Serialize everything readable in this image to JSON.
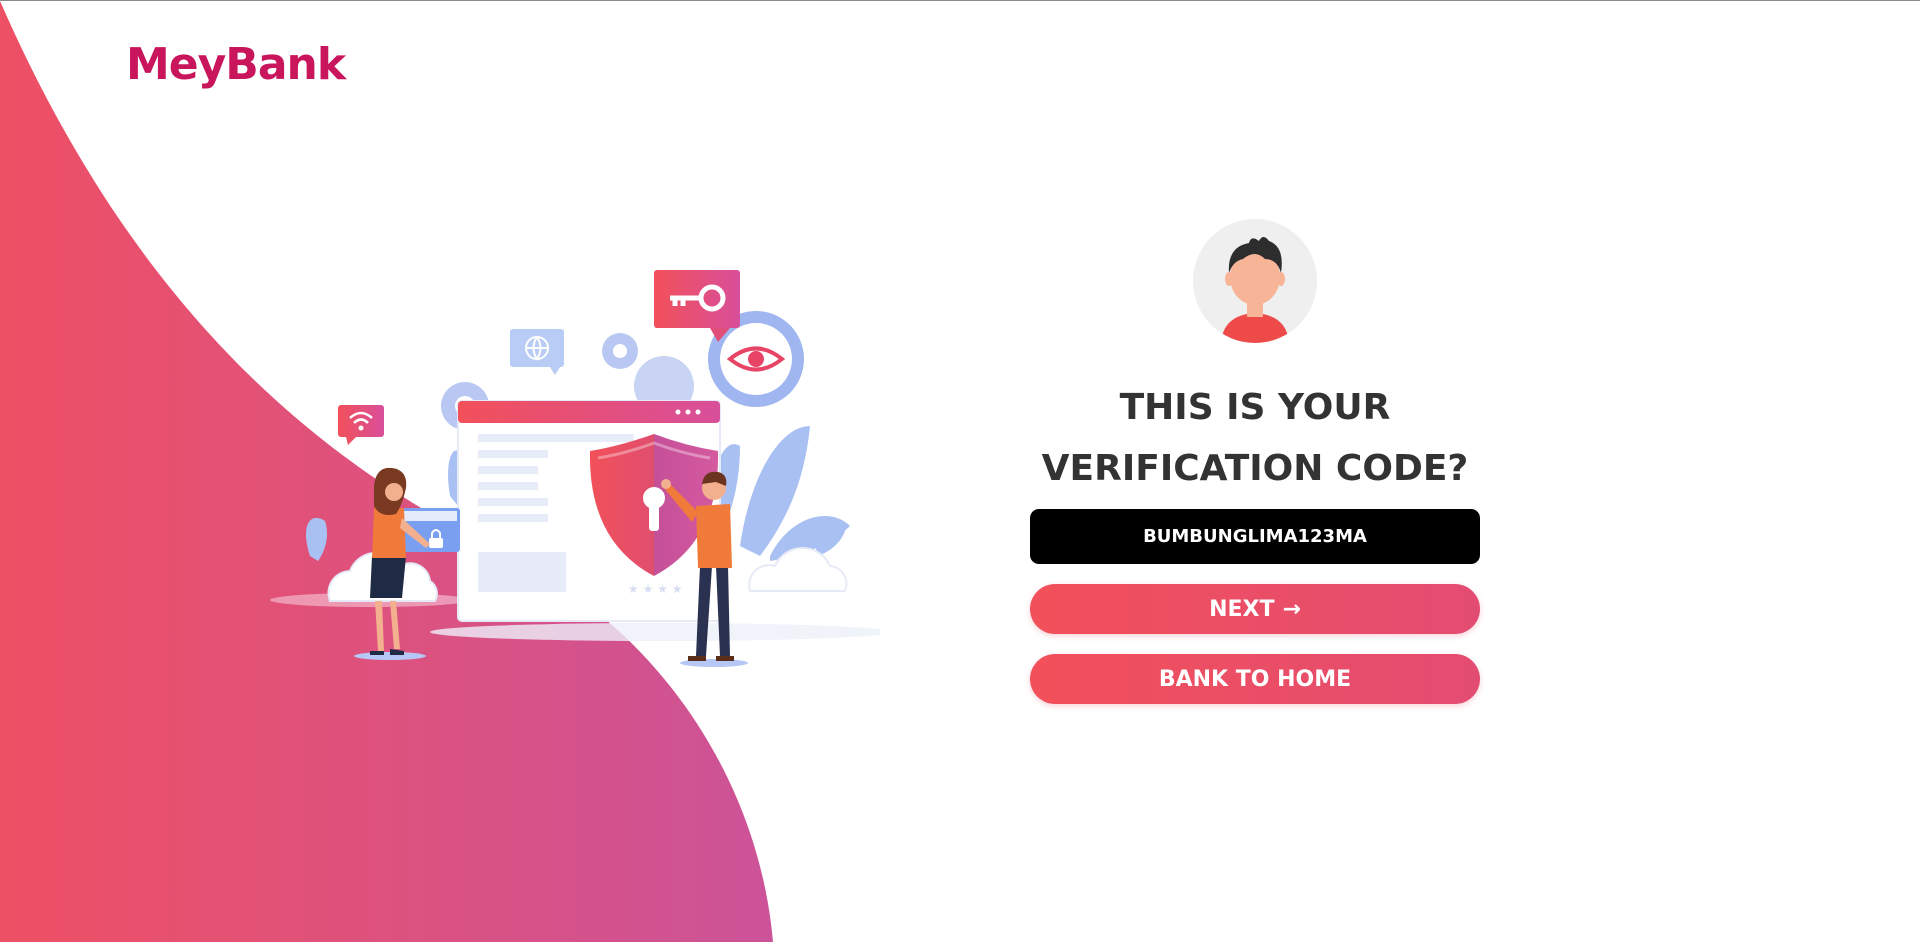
{
  "brand": {
    "logo_text": "MeyBank",
    "color": "#c8155c"
  },
  "illustration": {
    "icons": [
      "wifi-icon",
      "globe-icon",
      "key-icon",
      "eye-icon",
      "gear-icon",
      "padlock-icon",
      "keyhole-icon",
      "shield-icon"
    ]
  },
  "verification": {
    "heading_line1": "THIS IS YOUR",
    "heading_line2": "VERIFICATION CODE?",
    "code": "BUMBUNGLIMA123MA",
    "next_label": "NEXT",
    "next_arrow": "→",
    "home_label": "BANK TO HOME"
  },
  "colors": {
    "accent_start": "#f2505a",
    "accent_end": "#d35096",
    "code_bg": "#000000",
    "heading": "#333333"
  }
}
